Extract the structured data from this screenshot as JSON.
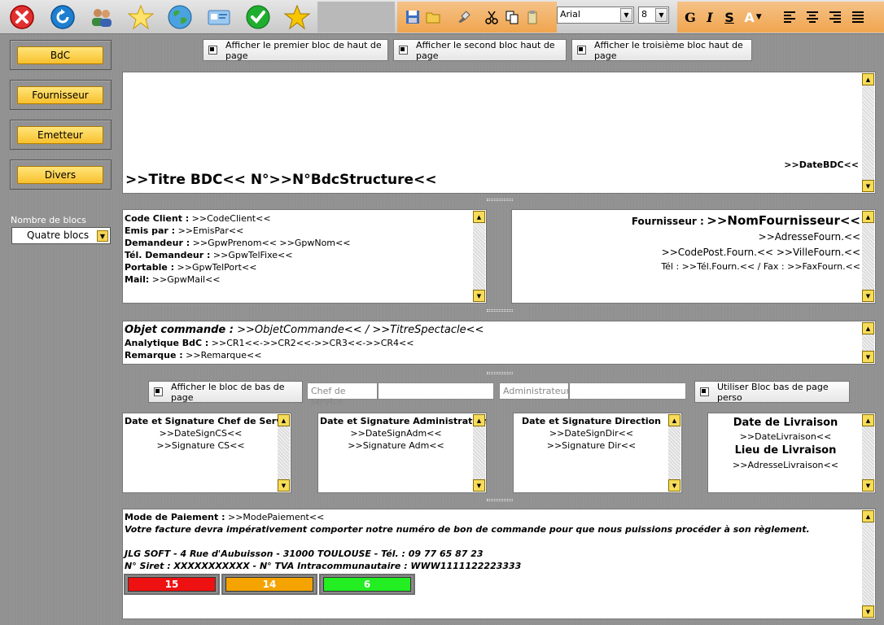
{
  "toolbar": {
    "font_name": "Arial",
    "font_size": "8",
    "bold_label": "G",
    "italic_label": "I",
    "strike_label": "S",
    "color_label": "A"
  },
  "sidebar": {
    "buttons": [
      "BdC",
      "Fournisseur",
      "Emetteur",
      "Divers"
    ],
    "blocks_label": "Nombre de blocs",
    "blocks_value": "Quatre blocs"
  },
  "header_toggles": [
    "Afficher le premier bloc de haut de page",
    "Afficher le second bloc haut de page",
    "Afficher le troisième bloc haut de page"
  ],
  "header_block": {
    "date": ">>DateBDC<<",
    "title": ">>Titre BDC<< N°>>N°BdcStructure<<"
  },
  "client_block": {
    "lines": [
      {
        "label": "Code Client :",
        "value": " >>CodeClient<<"
      },
      {
        "label": "Emis par :",
        "value": " >>EmisPar<<"
      },
      {
        "label": "Demandeur :",
        "value": " >>GpwPrenom<< >>GpwNom<<"
      },
      {
        "label": "Tél. Demandeur :",
        "value": " >>GpwTelFixe<<"
      },
      {
        "label": "Portable :",
        "value": " >>GpwTelPort<<"
      },
      {
        "label": "Mail:",
        "value": " >>GpwMail<<"
      }
    ]
  },
  "supplier_block": {
    "label": "Fournisseur :",
    "name": ">>NomFournisseur<<",
    "address": ">>AdresseFourn.<<",
    "city": ">>CodePost.Fourn.<< >>VilleFourn.<<",
    "phone": "Tél : >>Tél.Fourn.<< / Fax : >>FaxFourn.<<"
  },
  "object_block": {
    "object_label": "Objet commande :",
    "object_value": " >>ObjetCommande<< / >>TitreSpectacle<<",
    "analytic_label": "Analytique BdC :",
    "analytic_value": " >>CR1<<->>CR2<<->>CR3<<->>CR4<<",
    "remark_label": "Remarque :",
    "remark_value": " >>Remarque<<"
  },
  "footer_controls": {
    "show_footer": "Afficher le bloc de bas de page",
    "chef_label": "Chef de service",
    "admin_label": "Administrateur",
    "custom_footer": "Utiliser Bloc bas de page perso"
  },
  "signatures": [
    {
      "title": "Date et Signature Chef de Service",
      "date": ">>DateSignCS<<",
      "sign": ">>Signature CS<<"
    },
    {
      "title": "Date et Signature Administration",
      "date": ">>DateSignAdm<<",
      "sign": ">>Signature Adm<<"
    },
    {
      "title": "Date et Signature Direction",
      "date": ">>DateSignDir<<",
      "sign": ">>Signature Dir<<"
    }
  ],
  "delivery": {
    "date_title": "Date de Livraison",
    "date_value": ">>DateLivraison<<",
    "place_title": "Lieu de Livraison",
    "place_value": ">>AdresseLivraison<<"
  },
  "bottom_block": {
    "payment_label": "Mode de Paiement :",
    "payment_value": " >>ModePaiement<<",
    "invoice_note": "Votre facture devra impérativement comporter notre numéro de bon de commande pour que nous puissions procéder à son règlement.",
    "address": "JLG SOFT - 4 Rue d'Aubuisson - 31000 TOULOUSE - Tél. : 09 77 65 87 23",
    "siret": "N° Siret : XXXXXXXXXXX - N° TVA Intracommunautaire : WWW1111122223333"
  },
  "counters": [
    {
      "value": "15",
      "color": "#ee1111"
    },
    {
      "value": "14",
      "color": "#f5a300"
    },
    {
      "value": "6",
      "color": "#22ee22"
    }
  ]
}
